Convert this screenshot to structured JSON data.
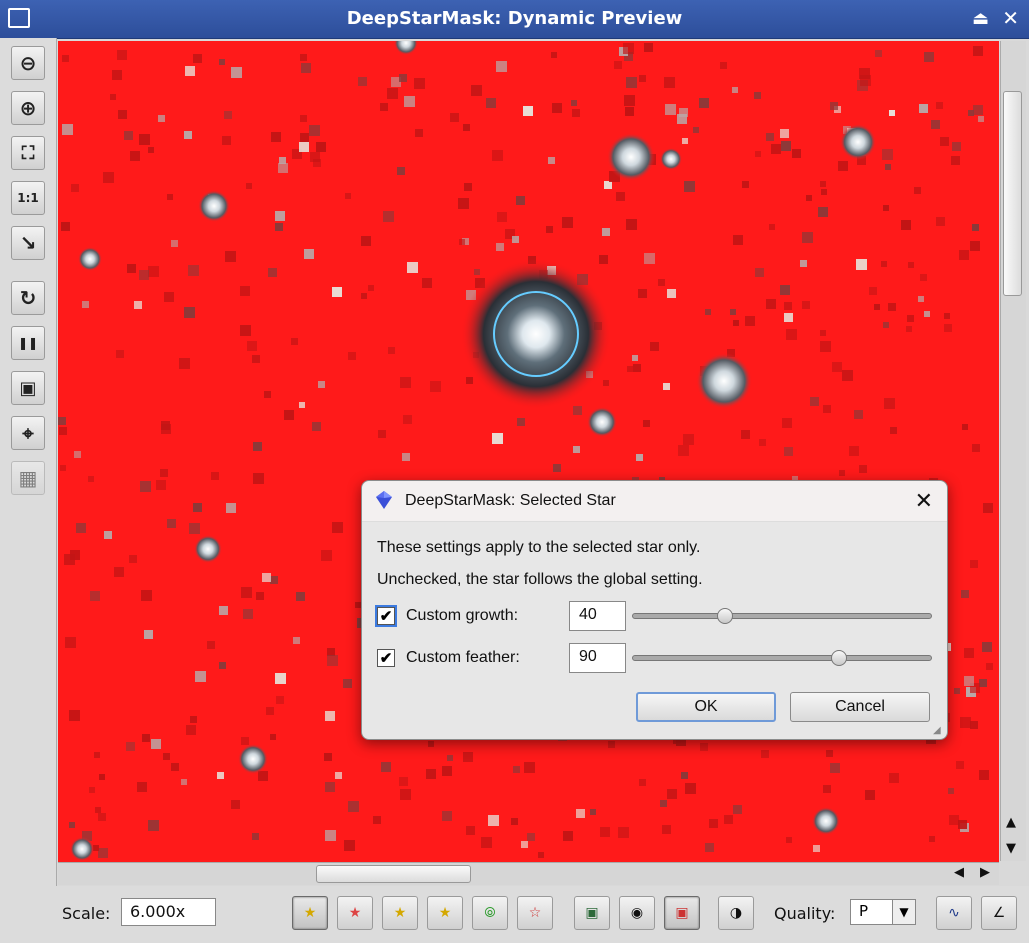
{
  "window": {
    "title": "DeepStarMask: Dynamic Preview"
  },
  "toolbar": {
    "tools": [
      {
        "name": "zoom-out-icon",
        "glyph": "⊖"
      },
      {
        "name": "zoom-in-icon",
        "glyph": "⊕"
      },
      {
        "name": "zoom-to-fit-icon",
        "glyph": "⛶"
      },
      {
        "name": "zoom-1-1-icon",
        "glyph": "1:1"
      },
      {
        "name": "arrow-diagonal-icon",
        "glyph": "↘"
      },
      {
        "name": "refresh-icon",
        "glyph": "↻"
      },
      {
        "name": "pause-icon",
        "glyph": "❚❚"
      },
      {
        "name": "export-image-icon",
        "glyph": "▣"
      },
      {
        "name": "crosshair-icon",
        "glyph": "⌖"
      },
      {
        "name": "grid-icon",
        "glyph": "▦"
      }
    ]
  },
  "dialog": {
    "title": "DeepStarMask: Selected Star",
    "line1": "These settings apply to the selected star only.",
    "line2": "Unchecked, the star follows the global setting.",
    "growth": {
      "label": "Custom growth:",
      "value": "40",
      "checked": true,
      "fraction": 0.31
    },
    "feather": {
      "label": "Custom feather:",
      "value": "90",
      "checked": true,
      "fraction": 0.69
    },
    "ok_label": "OK",
    "cancel_label": "Cancel"
  },
  "bottombar": {
    "scale_label": "Scale:",
    "scale_value": "6.000x",
    "quality_label": "Quality:",
    "quality_value": "P"
  },
  "colors": {
    "mask_background": "#ff1a1a",
    "titlebar": "#3558a7",
    "selection_ring": "#66ccff"
  }
}
